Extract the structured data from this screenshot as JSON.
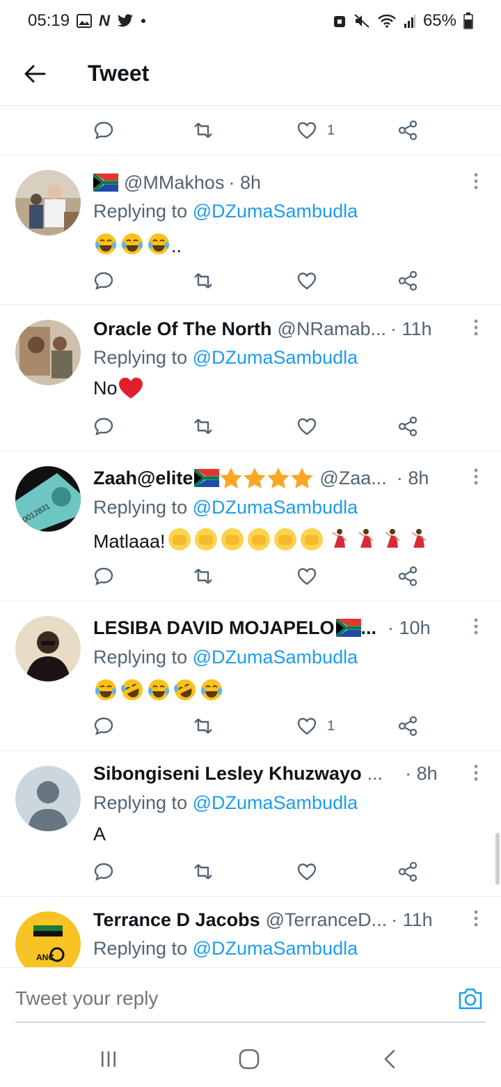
{
  "status_bar": {
    "time": "05:19",
    "battery": "65%"
  },
  "header": {
    "title": "Tweet"
  },
  "top_actions": {
    "like_count": "1"
  },
  "tweets": [
    {
      "display_name": "",
      "handle": "@MMakhos",
      "time": "· 8h",
      "replying_label": "Replying to",
      "replying_to": "@DZumaSambudla",
      "text": "..",
      "like_count": ""
    },
    {
      "display_name": "Oracle Of The North",
      "handle": "@NRamab...",
      "time": "· 11h",
      "replying_label": "Replying to",
      "replying_to": "@DZumaSambudla",
      "text": "No",
      "like_count": ""
    },
    {
      "display_name": "Zaah@elite",
      "handle": "@Zaa...",
      "time": "· 8h",
      "replying_label": "Replying to",
      "replying_to": "@DZumaSambudla",
      "text": "Matlaaa!",
      "like_count": ""
    },
    {
      "display_name": "LESIBA DAVID MOJAPELO",
      "handle": "...",
      "time": "· 10h",
      "replying_label": "Replying to",
      "replying_to": "@DZumaSambudla",
      "text": "",
      "like_count": "1"
    },
    {
      "display_name": "Sibongiseni Lesley Khuzwayo",
      "handle": "...",
      "time": "· 8h",
      "replying_label": "Replying to",
      "replying_to": "@DZumaSambudla",
      "text": "A",
      "like_count": ""
    },
    {
      "display_name": "Terrance D Jacobs",
      "handle": "@TerranceD...",
      "time": "· 11h",
      "replying_label": "Replying to",
      "replying_to": "@DZumaSambudla",
      "text": "",
      "like_count": ""
    }
  ],
  "composer": {
    "placeholder": "Tweet your reply"
  },
  "colors": {
    "link": "#1d9bf0",
    "secondary_text": "#536471",
    "divider": "#e6ecf0"
  }
}
